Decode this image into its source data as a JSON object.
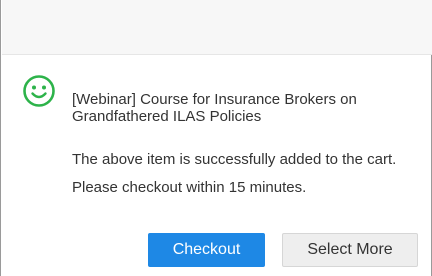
{
  "dialog": {
    "item_title": "[Webinar] Course for Insurance Brokers on Grandfathered ILAS Policies",
    "message": "The above item is successfully added to the cart.  Please checkout within 15 minutes.",
    "status_icon": "smiley-icon",
    "accent_color": "#1e88e5",
    "icon_color": "#2db34a"
  },
  "actions": {
    "checkout_label": "Checkout",
    "select_more_label": "Select More"
  }
}
